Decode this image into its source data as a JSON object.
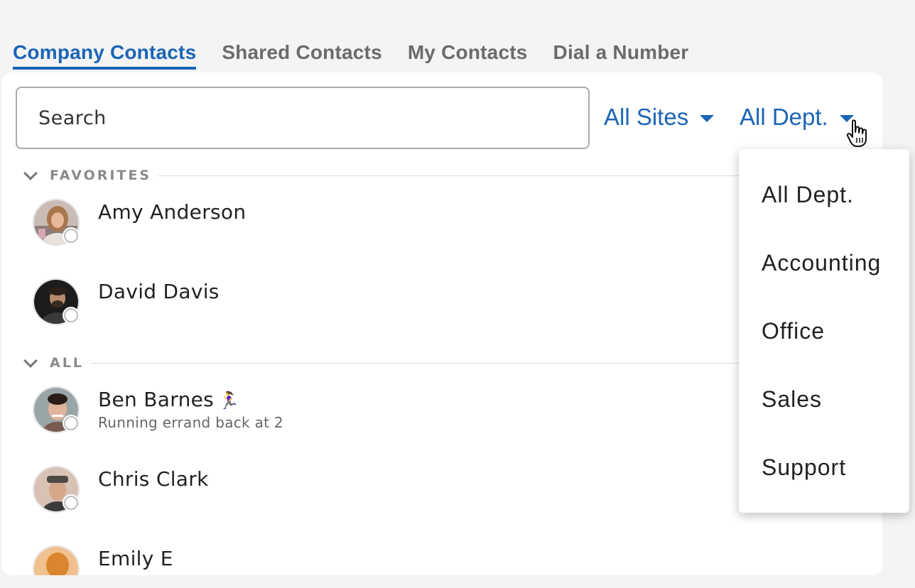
{
  "tabs": [
    {
      "label": "Company Contacts",
      "active": true
    },
    {
      "label": "Shared Contacts",
      "active": false
    },
    {
      "label": "My Contacts",
      "active": false
    },
    {
      "label": "Dial a Number",
      "active": false
    }
  ],
  "search": {
    "placeholder": "Search"
  },
  "filters": {
    "sites_label": "All Sites",
    "dept_label": "All Dept."
  },
  "sections": {
    "favorites": "FAVORITES",
    "all": "ALL"
  },
  "favorites": [
    {
      "name": "Amy Anderson"
    },
    {
      "name": "David Davis"
    }
  ],
  "all_contacts": [
    {
      "name": "Ben Barnes",
      "emoji": "🏃‍♀️",
      "status": "Running errand back at 2"
    },
    {
      "name": "Chris Clark"
    },
    {
      "name": "Emily E"
    }
  ],
  "dept_dropdown": {
    "options": [
      "All Dept.",
      "Accounting",
      "Office",
      "Sales",
      "Support"
    ]
  },
  "colors": {
    "accent": "#1b65b5",
    "background": "#f4f4f4",
    "panel": "#ffffff"
  }
}
